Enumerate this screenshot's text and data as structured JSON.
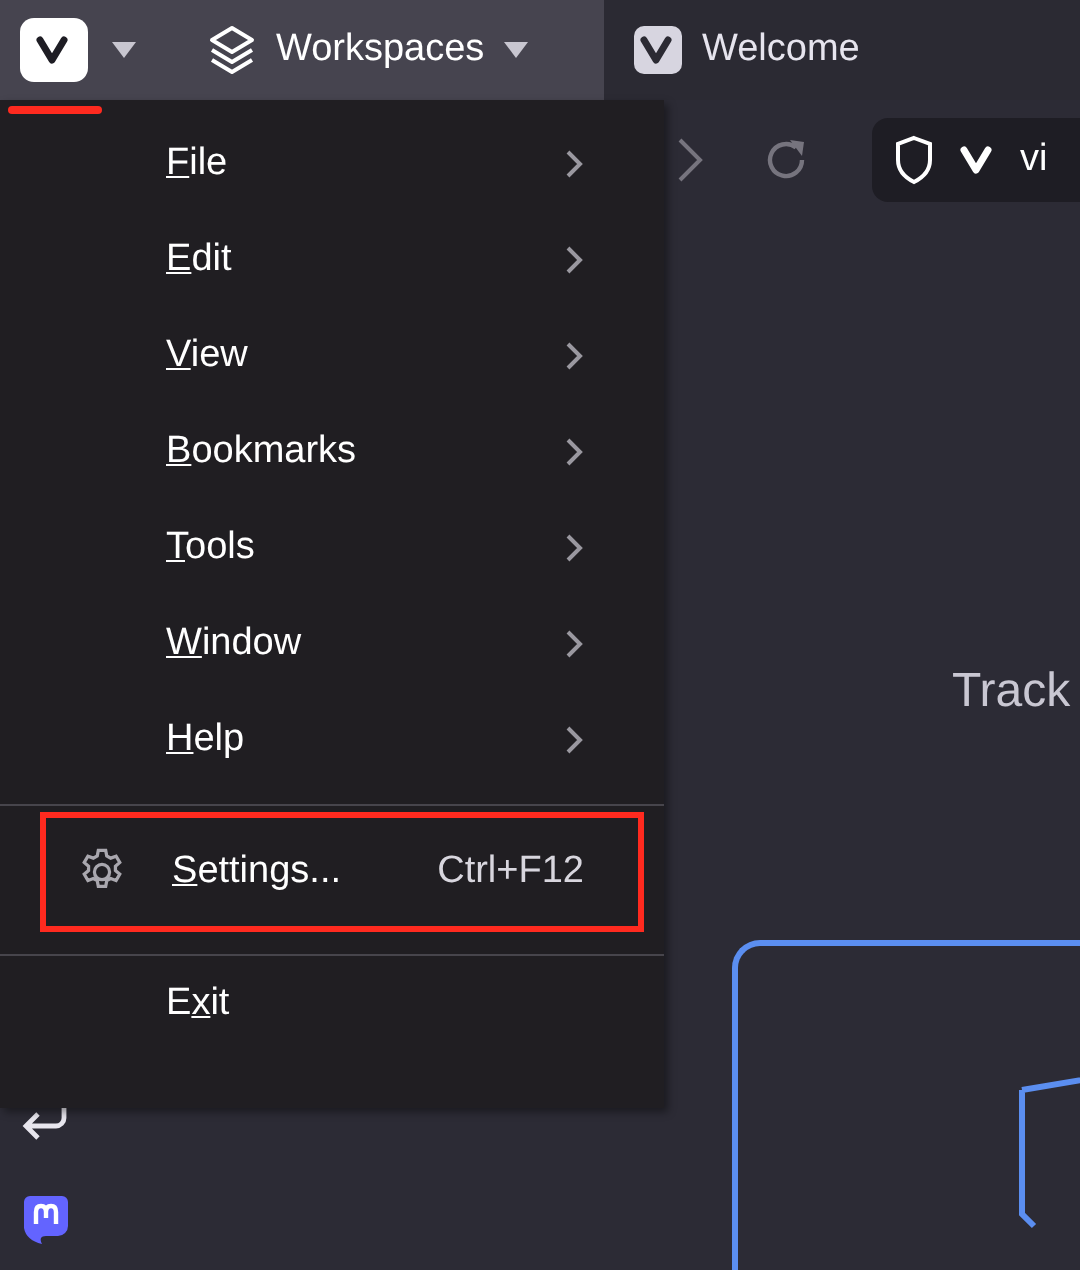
{
  "menu_button": {
    "highlighted": true
  },
  "workspaces": {
    "label": "Workspaces"
  },
  "tab": {
    "title": "Welcome"
  },
  "address_bar": {
    "text": "vi"
  },
  "page": {
    "heading": "Track"
  },
  "menu": {
    "items": [
      {
        "kind": "submenu",
        "access_key": "F",
        "label_rest": "ile"
      },
      {
        "kind": "submenu",
        "access_key": "E",
        "label_rest": "dit"
      },
      {
        "kind": "submenu",
        "access_key": "V",
        "label_rest": "iew"
      },
      {
        "kind": "submenu",
        "access_key": "B",
        "label_rest": "ookmarks"
      },
      {
        "kind": "submenu",
        "access_key": "T",
        "label_rest": "ools"
      },
      {
        "kind": "submenu",
        "access_key": "W",
        "label_rest": "indow"
      },
      {
        "kind": "submenu",
        "access_key": "H",
        "label_rest": "elp"
      },
      {
        "kind": "separator"
      },
      {
        "kind": "icon_command",
        "access_key": "S",
        "label_rest": "ettings...",
        "shortcut": "Ctrl+F12",
        "highlighted": true
      },
      {
        "kind": "separator"
      },
      {
        "kind": "command",
        "label_start": "E",
        "access_key": "x",
        "label_rest": "it",
        "highlighted": false
      }
    ]
  }
}
